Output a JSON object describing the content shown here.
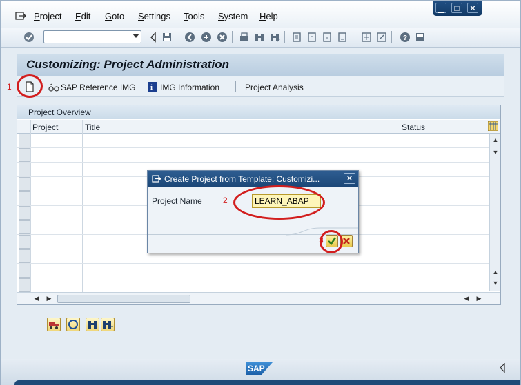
{
  "menu": {
    "items": [
      {
        "label": "Project",
        "mnemonic": "P",
        "rest": "roject"
      },
      {
        "label": "Edit",
        "mnemonic": "E",
        "rest": "dit"
      },
      {
        "label": "Goto",
        "mnemonic": "G",
        "rest": "oto"
      },
      {
        "label": "Settings",
        "mnemonic": "S",
        "rest": "ettings"
      },
      {
        "label": "Tools",
        "mnemonic": "T",
        "rest": "ools"
      },
      {
        "label": "System",
        "mnemonic": "S",
        "rest": "ystem"
      },
      {
        "label": "Help",
        "mnemonic": "H",
        "rest": "elp"
      }
    ]
  },
  "window_controls": {
    "minimize": "▁",
    "restore": "□",
    "close": "✕"
  },
  "page": {
    "title": "Customizing: Project Administration"
  },
  "app_toolbar": {
    "sap_reference_img": "SAP Reference IMG",
    "img_information": "IMG Information",
    "project_analysis": "Project Analysis"
  },
  "overview": {
    "title": "Project Overview",
    "columns": {
      "project": "Project",
      "title": "Title",
      "status": "Status"
    },
    "rows": []
  },
  "dialog": {
    "title": "Create Project from Template: Customizi...",
    "project_name_label": "Project Name",
    "project_name_value": "LEARN_ABAP"
  },
  "annotations": {
    "step1": "1",
    "step2": "2",
    "step3": "3"
  },
  "footer": {
    "logo_text": "SAP"
  },
  "colors": {
    "annotation_red": "#d21e1e",
    "dialog_title_bg": "#1b4676",
    "input_bg": "#fdf5b9"
  }
}
